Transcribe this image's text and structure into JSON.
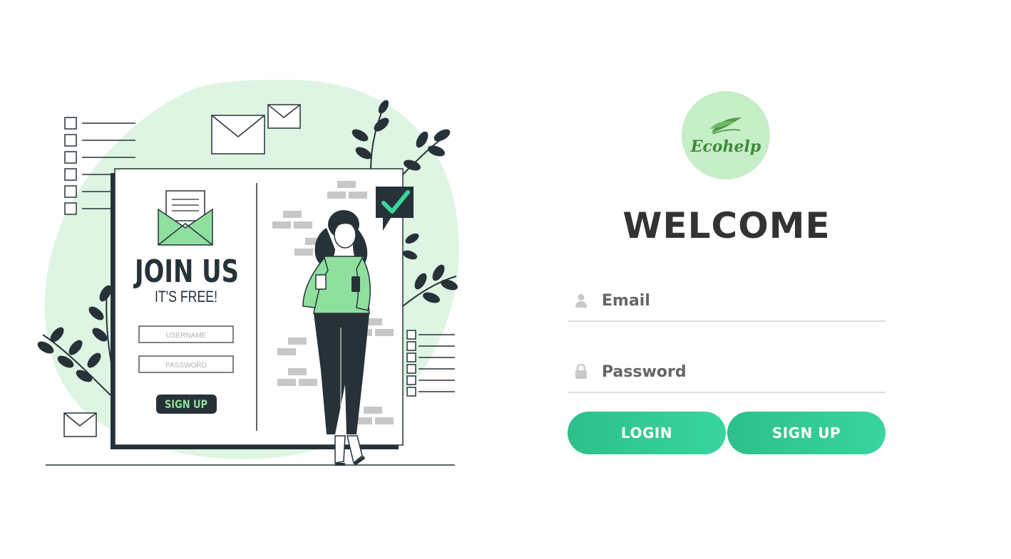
{
  "illustration": {
    "join_title": "JOIN US",
    "join_subtitle": "IT'S FREE!",
    "username_placeholder": "USERNAME",
    "password_placeholder": "PASSWORD",
    "signup_label": "SIGN UP"
  },
  "brand": {
    "name": "Ecohelp"
  },
  "form": {
    "title": "WELCOME",
    "email_placeholder": "Email",
    "password_placeholder": "Password",
    "login_label": "LOGIN",
    "signup_label": "SIGN UP"
  },
  "colors": {
    "accent": "#38d69c",
    "blob": "#dff5e3",
    "dark": "#263238",
    "logo_bg": "#c6eec7"
  }
}
